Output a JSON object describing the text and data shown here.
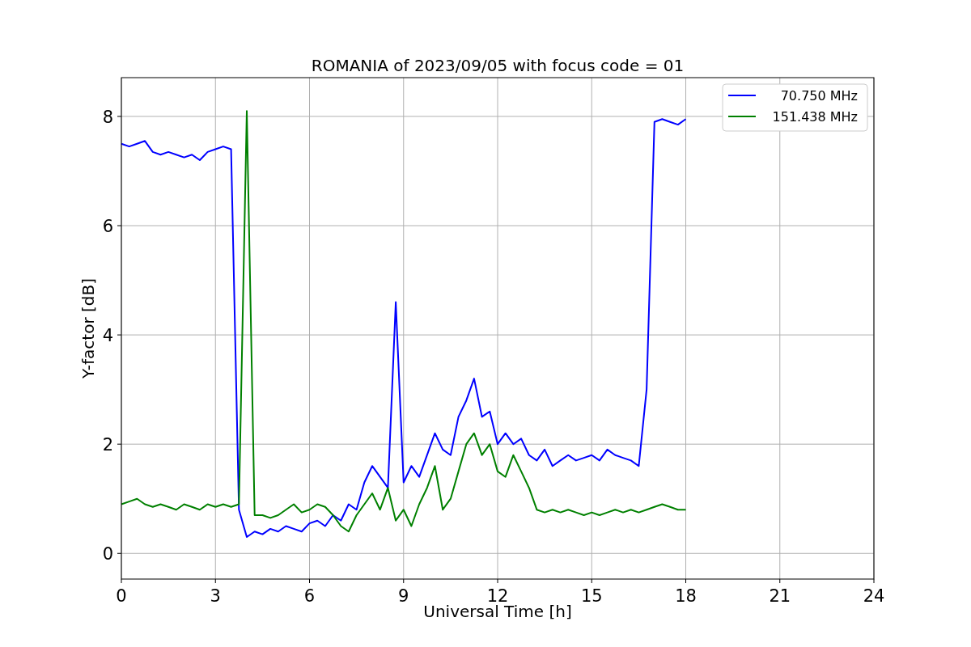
{
  "chart_data": {
    "type": "line",
    "title": "ROMANIA of 2023/09/05 with focus code = 01",
    "xlabel": "Universal Time [h]",
    "ylabel": "Y-factor [dB]",
    "x": [
      0,
      0.25,
      0.5,
      0.75,
      1,
      1.25,
      1.5,
      1.75,
      2,
      2.25,
      2.5,
      2.75,
      3,
      3.25,
      3.5,
      3.75,
      4,
      4.25,
      4.5,
      4.75,
      5,
      5.25,
      5.5,
      5.75,
      6,
      6.25,
      6.5,
      6.75,
      7,
      7.25,
      7.5,
      7.75,
      8,
      8.25,
      8.5,
      8.75,
      9,
      9.25,
      9.5,
      9.75,
      10,
      10.25,
      10.5,
      10.75,
      11,
      11.25,
      11.5,
      11.75,
      12,
      12.25,
      12.5,
      12.75,
      13,
      13.25,
      13.5,
      13.75,
      14,
      14.25,
      14.5,
      14.75,
      15,
      15.25,
      15.5,
      15.75,
      16,
      16.25,
      16.5,
      16.75,
      17,
      17.25,
      17.5,
      17.75,
      18
    ],
    "series": [
      {
        "name": "70.750 MHz",
        "color": "#0000ff",
        "values": [
          7.5,
          7.45,
          7.5,
          7.55,
          7.35,
          7.3,
          7.35,
          7.3,
          7.25,
          7.3,
          7.2,
          7.35,
          7.4,
          7.45,
          7.4,
          0.8,
          0.3,
          0.4,
          0.35,
          0.45,
          0.4,
          0.5,
          0.45,
          0.4,
          0.55,
          0.6,
          0.5,
          0.7,
          0.6,
          0.9,
          0.8,
          1.3,
          1.6,
          1.4,
          1.2,
          4.6,
          1.3,
          1.6,
          1.4,
          1.8,
          2.2,
          1.9,
          1.8,
          2.5,
          2.8,
          3.2,
          2.5,
          2.6,
          2.0,
          2.2,
          2.0,
          2.1,
          1.8,
          1.7,
          1.9,
          1.6,
          1.7,
          1.8,
          1.7,
          1.75,
          1.8,
          1.7,
          1.9,
          1.8,
          1.75,
          1.7,
          1.6,
          3.0,
          7.9,
          7.95,
          7.9,
          7.85,
          7.95
        ]
      },
      {
        "name": "151.438 MHz",
        "color": "#008000",
        "values": [
          0.9,
          0.95,
          1.0,
          0.9,
          0.85,
          0.9,
          0.85,
          0.8,
          0.9,
          0.85,
          0.8,
          0.9,
          0.85,
          0.9,
          0.85,
          0.9,
          8.1,
          0.7,
          0.7,
          0.65,
          0.7,
          0.8,
          0.9,
          0.75,
          0.8,
          0.9,
          0.85,
          0.7,
          0.5,
          0.4,
          0.7,
          0.9,
          1.1,
          0.8,
          1.2,
          0.6,
          0.8,
          0.5,
          0.9,
          1.2,
          1.6,
          0.8,
          1.0,
          1.5,
          2.0,
          2.2,
          1.8,
          2.0,
          1.5,
          1.4,
          1.8,
          1.5,
          1.2,
          0.8,
          0.75,
          0.8,
          0.75,
          0.8,
          0.75,
          0.7,
          0.75,
          0.7,
          0.75,
          0.8,
          0.75,
          0.8,
          0.75,
          0.8,
          0.85,
          0.9,
          0.85,
          0.8,
          0.8
        ]
      }
    ],
    "grid": true,
    "legend": true,
    "xlim": [
      0,
      24
    ],
    "ylim": [
      -0.47,
      8.71
    ],
    "xticks": [
      0,
      3,
      6,
      9,
      12,
      15,
      18,
      21,
      24
    ],
    "yticks": [
      0,
      2,
      4,
      6,
      8
    ]
  }
}
